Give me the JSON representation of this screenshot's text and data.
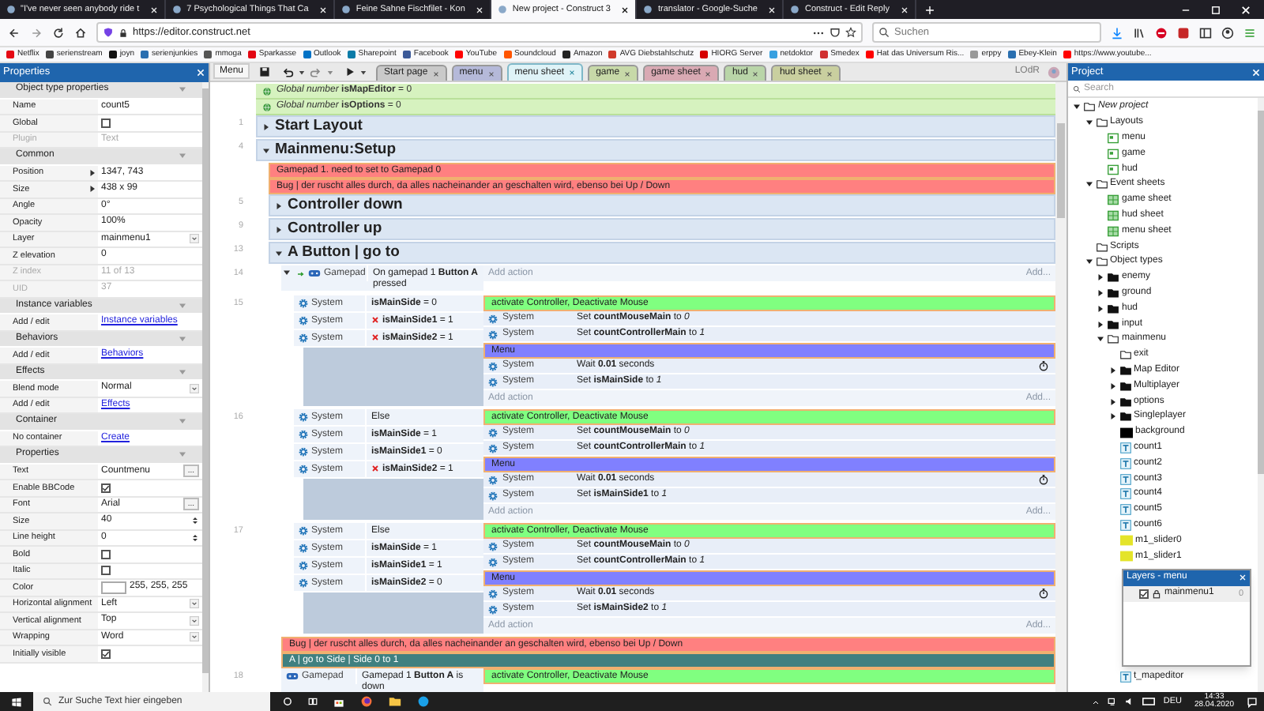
{
  "browser": {
    "tabs": [
      {
        "title": "\"I've never seen anybody ride t",
        "selected": false
      },
      {
        "title": "7 Psychological Things That Ca",
        "selected": false
      },
      {
        "title": "Feine Sahne Fischfilet - Kon",
        "selected": false
      },
      {
        "title": "New project - Construct 3",
        "selected": true
      },
      {
        "title": "translator - Google-Suche",
        "selected": false
      },
      {
        "title": "Construct - Edit Reply",
        "selected": false
      }
    ],
    "url": "https://editor.construct.net",
    "search_placeholder": "Suchen",
    "bookmarks": [
      {
        "label": "Netflix",
        "color": "#e50914"
      },
      {
        "label": "serienstream",
        "color": "#444444"
      },
      {
        "label": "joyn",
        "color": "#111111"
      },
      {
        "label": "serienjunkies",
        "color": "#2a6fb0"
      },
      {
        "label": "mmoga",
        "color": "#555555"
      },
      {
        "label": "Sparkasse",
        "color": "#e30613"
      },
      {
        "label": "Outlook",
        "color": "#0072c6"
      },
      {
        "label": "Sharepoint",
        "color": "#0a7ba8"
      },
      {
        "label": "Facebook",
        "color": "#3b5998"
      },
      {
        "label": "YouTube",
        "color": "#ff0000"
      },
      {
        "label": "Soundcloud",
        "color": "#ff5500"
      },
      {
        "label": "Amazon",
        "color": "#222222"
      },
      {
        "label": "AVG Diebstahlschutz",
        "color": "#d03a2a"
      },
      {
        "label": "HIORG Server",
        "color": "#d60000"
      },
      {
        "label": "netdoktor",
        "color": "#37a0e0"
      },
      {
        "label": "Smedex",
        "color": "#d03030"
      },
      {
        "label": "Hat das Universum Ris...",
        "color": "#ff0000"
      },
      {
        "label": "erppy",
        "color": "#999999"
      },
      {
        "label": "Ebey-Klein",
        "color": "#2a6fb0"
      },
      {
        "label": "https://www.youtube...",
        "color": "#ff0000"
      }
    ]
  },
  "properties": {
    "title": "Properties",
    "sections": [
      {
        "title": "Object type properties",
        "rows": [
          {
            "label": "Name",
            "value": "count5",
            "kind": "text"
          },
          {
            "label": "Global",
            "kind": "checkbox",
            "checked": false
          },
          {
            "label": "Plugin",
            "value": "Text",
            "kind": "readonly"
          }
        ]
      },
      {
        "title": "Common",
        "rows": [
          {
            "label": "Position",
            "value": "1347, 743",
            "kind": "expand"
          },
          {
            "label": "Size",
            "value": "438 x 99",
            "kind": "expand"
          },
          {
            "label": "Angle",
            "value": "0°",
            "kind": "text"
          },
          {
            "label": "Opacity",
            "value": "100%",
            "kind": "text"
          },
          {
            "label": "Layer",
            "value": "mainmenu1",
            "kind": "select"
          },
          {
            "label": "Z elevation",
            "value": "0",
            "kind": "text"
          },
          {
            "label": "Z index",
            "value": "11 of 13",
            "kind": "readonly"
          },
          {
            "label": "UID",
            "value": "37",
            "kind": "readonly"
          }
        ]
      },
      {
        "title": "Instance variables",
        "rows": [
          {
            "label": "Add / edit",
            "value": "Instance variables",
            "kind": "link"
          }
        ]
      },
      {
        "title": "Behaviors",
        "rows": [
          {
            "label": "Add / edit",
            "value": "Behaviors",
            "kind": "link"
          }
        ]
      },
      {
        "title": "Effects",
        "rows": [
          {
            "label": "Blend mode",
            "value": "Normal",
            "kind": "select"
          },
          {
            "label": "Add / edit",
            "value": "Effects",
            "kind": "link"
          }
        ]
      },
      {
        "title": "Container",
        "rows": [
          {
            "label": "No container",
            "value": "Create",
            "kind": "link"
          }
        ]
      },
      {
        "title": "Properties",
        "rows": [
          {
            "label": "Text",
            "value": "Countmenu",
            "kind": "button",
            "button_label": "..."
          },
          {
            "label": "Enable BBCode",
            "kind": "checkbox",
            "checked": true
          },
          {
            "label": "Font",
            "value": "Arial",
            "kind": "button",
            "button_label": "..."
          },
          {
            "label": "Size",
            "value": "40",
            "kind": "spin"
          },
          {
            "label": "Line height",
            "value": "0",
            "kind": "spin"
          },
          {
            "label": "Bold",
            "kind": "checkbox",
            "checked": false
          },
          {
            "label": "Italic",
            "kind": "checkbox",
            "checked": false
          },
          {
            "label": "Color",
            "value": "255, 255, 255",
            "kind": "color"
          },
          {
            "label": "Horizontal alignment",
            "value": "Left",
            "kind": "select"
          },
          {
            "label": "Vertical alignment",
            "value": "Top",
            "kind": "select"
          },
          {
            "label": "Wrapping",
            "value": "Word",
            "kind": "select"
          },
          {
            "label": "Initially visible",
            "kind": "checkbox",
            "checked": true
          }
        ]
      }
    ]
  },
  "toolbar": {
    "menu_button": "Menu",
    "tabs": [
      {
        "label": "Start page",
        "selected": false,
        "color": "#c9c9c9"
      },
      {
        "label": "menu",
        "selected": false,
        "color": "#b5b9d9"
      },
      {
        "label": "menu sheet",
        "selected": true,
        "color": "#dff3f7"
      },
      {
        "label": "game",
        "selected": false,
        "color": "#c7d9a8"
      },
      {
        "label": "game sheet",
        "selected": false,
        "color": "#d9a9b3"
      },
      {
        "label": "hud",
        "selected": false,
        "color": "#b9d5a8"
      },
      {
        "label": "hud sheet",
        "selected": false,
        "color": "#c9cf9f"
      }
    ],
    "user": "LOdR"
  },
  "event_sheet": [
    {
      "kind": "global",
      "text": "*Global number* **isMapEditor** = 0"
    },
    {
      "kind": "global",
      "text": "*Global number* **isOptions** = 0"
    },
    {
      "kind": "group",
      "line": "1",
      "title": "Start Layout",
      "expanded": false
    },
    {
      "kind": "group",
      "line": "4",
      "title": "Mainmenu:Setup",
      "expanded": true,
      "children": [
        {
          "kind": "comment",
          "text": "Gamepad 1. need to set to Gamepad 0",
          "color": "#ff8080"
        },
        {
          "kind": "comment",
          "text": "Bug | der ruscht alles durch, da alles nacheinander an geschalten wird, ebenso bei Up / Down",
          "color": "#ff8080"
        },
        {
          "kind": "group",
          "line": "5",
          "title": "Controller down",
          "expanded": false
        },
        {
          "kind": "group",
          "line": "9",
          "title": "Controller up",
          "expanded": false
        },
        {
          "kind": "group",
          "line": "13",
          "title": "A Button | go to",
          "expanded": true,
          "children": [
            {
              "kind": "event",
              "line": "14",
              "expanded": true,
              "conditions": [
                {
                  "kind": "gamepad_trigger",
                  "object": "Gamepad",
                  "text": "On gamepad 1 **Button A** pressed",
                  "inverted": false
                }
              ],
              "add_action": {
                "label": "Add action",
                "button": "Add..."
              },
              "children": [
                {
                  "kind": "event",
                  "line": "15",
                  "conditions": [
                    {
                      "kind": "system",
                      "object": "System",
                      "text": "**isMainSide** = 0",
                      "inverted": false
                    },
                    {
                      "kind": "system",
                      "object": "System",
                      "text": "**isMainSide1** = 1",
                      "inverted": true
                    },
                    {
                      "kind": "system",
                      "object": "System",
                      "text": "**isMainSide2** = 1",
                      "inverted": true
                    }
                  ],
                  "actions": [
                    {
                      "kind": "comment",
                      "text": "activate Controller, Deactivate Mouse",
                      "color": "#80ff80"
                    },
                    {
                      "kind": "action",
                      "object": "System",
                      "text": "Set **countMouseMain** to *0*"
                    },
                    {
                      "kind": "action",
                      "object": "System",
                      "text": "Set **countControllerMain** to *1*"
                    },
                    {
                      "kind": "comment",
                      "text": "Menu",
                      "color": "#8080ff"
                    },
                    {
                      "kind": "wait",
                      "object": "System",
                      "text": "Wait **0.01** seconds"
                    },
                    {
                      "kind": "action",
                      "object": "System",
                      "text": "Set **isMainSide** to *1*"
                    }
                  ],
                  "add_action": {
                    "label": "Add action",
                    "button": "Add..."
                  }
                },
                {
                  "kind": "event",
                  "line": "16",
                  "conditions": [
                    {
                      "kind": "system",
                      "object": "System",
                      "text": "Else",
                      "inverted": false
                    },
                    {
                      "kind": "system",
                      "object": "System",
                      "text": "**isMainSide** = 1",
                      "inverted": false
                    },
                    {
                      "kind": "system",
                      "object": "System",
                      "text": "**isMainSide1** = 0",
                      "inverted": false
                    },
                    {
                      "kind": "system",
                      "object": "System",
                      "text": "**isMainSide2** = 1",
                      "inverted": true
                    }
                  ],
                  "actions": [
                    {
                      "kind": "comment",
                      "text": "activate Controller, Deactivate Mouse",
                      "color": "#80ff80"
                    },
                    {
                      "kind": "action",
                      "object": "System",
                      "text": "Set **countMouseMain** to *0*"
                    },
                    {
                      "kind": "action",
                      "object": "System",
                      "text": "Set **countControllerMain** to *1*"
                    },
                    {
                      "kind": "comment",
                      "text": "Menu",
                      "color": "#8080ff"
                    },
                    {
                      "kind": "wait",
                      "object": "System",
                      "text": "Wait **0.01** seconds"
                    },
                    {
                      "kind": "action",
                      "object": "System",
                      "text": "Set **isMainSide1** to *1*"
                    }
                  ],
                  "add_action": {
                    "label": "Add action",
                    "button": "Add..."
                  }
                },
                {
                  "kind": "event",
                  "line": "17",
                  "conditions": [
                    {
                      "kind": "system",
                      "object": "System",
                      "text": "Else",
                      "inverted": false
                    },
                    {
                      "kind": "system",
                      "object": "System",
                      "text": "**isMainSide** = 1",
                      "inverted": false
                    },
                    {
                      "kind": "system",
                      "object": "System",
                      "text": "**isMainSide1** = 1",
                      "inverted": false
                    },
                    {
                      "kind": "system",
                      "object": "System",
                      "text": "**isMainSide2** = 0",
                      "inverted": false
                    }
                  ],
                  "actions": [
                    {
                      "kind": "comment",
                      "text": "activate Controller, Deactivate Mouse",
                      "color": "#80ff80"
                    },
                    {
                      "kind": "action",
                      "object": "System",
                      "text": "Set **countMouseMain** to *0*"
                    },
                    {
                      "kind": "action",
                      "object": "System",
                      "text": "Set **countControllerMain** to *1*"
                    },
                    {
                      "kind": "comment",
                      "text": "Menu",
                      "color": "#8080ff"
                    },
                    {
                      "kind": "wait",
                      "object": "System",
                      "text": "Wait **0.01** seconds"
                    },
                    {
                      "kind": "action",
                      "object": "System",
                      "text": "Set **isMainSide2** to *1*"
                    }
                  ],
                  "add_action": {
                    "label": "Add action",
                    "button": "Add..."
                  }
                }
              ]
            },
            {
              "kind": "comment",
              "text": "Bug | der ruscht alles durch, da alles nacheinander an geschalten wird, ebenso bei Up / Down",
              "color": "#ff8080"
            },
            {
              "kind": "comment",
              "text": "A | go to Side | Side 0 to 1",
              "color": "#408080"
            },
            {
              "kind": "event",
              "line": "18",
              "conditions": [
                {
                  "kind": "gamepad",
                  "object": "Gamepad",
                  "text": "Gamepad 1 **Button A** is down",
                  "inverted": false
                }
              ],
              "actions": [
                {
                  "kind": "comment",
                  "text": "activate Controller, Deactivate Mouse",
                  "color": "#80ff80"
                }
              ]
            }
          ]
        }
      ]
    }
  ],
  "project": {
    "title": "Project",
    "search_placeholder": "Search",
    "tree": [
      {
        "label": "New project",
        "kind": "project",
        "expanded": true,
        "children": [
          {
            "label": "Layouts",
            "kind": "folder",
            "expanded": true,
            "children": [
              {
                "label": "menu",
                "kind": "layout"
              },
              {
                "label": "game",
                "kind": "layout"
              },
              {
                "label": "hud",
                "kind": "layout"
              }
            ]
          },
          {
            "label": "Event sheets",
            "kind": "folder",
            "expanded": true,
            "children": [
              {
                "label": "game sheet",
                "kind": "sheet"
              },
              {
                "label": "hud sheet",
                "kind": "sheet"
              },
              {
                "label": "menu sheet",
                "kind": "sheet"
              }
            ]
          },
          {
            "label": "Scripts",
            "kind": "empty_folder"
          },
          {
            "label": "Object types",
            "kind": "folder",
            "expanded": true,
            "children": [
              {
                "label": "enemy",
                "kind": "folder",
                "expanded": false
              },
              {
                "label": "ground",
                "kind": "folder",
                "expanded": false
              },
              {
                "label": "hud",
                "kind": "folder",
                "expanded": false
              },
              {
                "label": "input",
                "kind": "folder",
                "expanded": false
              },
              {
                "label": "mainmenu",
                "kind": "folder",
                "expanded": true,
                "children": [
                  {
                    "label": "exit",
                    "kind": "empty_folder"
                  },
                  {
                    "label": "Map Editor",
                    "kind": "folder",
                    "expanded": false
                  },
                  {
                    "label": "Multiplayer",
                    "kind": "folder",
                    "expanded": false
                  },
                  {
                    "label": "options",
                    "kind": "folder",
                    "expanded": false
                  },
                  {
                    "label": "Singleplayer",
                    "kind": "folder",
                    "expanded": false
                  },
                  {
                    "label": "background",
                    "kind": "sprite",
                    "color": "#000000"
                  },
                  {
                    "label": "count1",
                    "kind": "text"
                  },
                  {
                    "label": "count2",
                    "kind": "text"
                  },
                  {
                    "label": "count3",
                    "kind": "text"
                  },
                  {
                    "label": "count4",
                    "kind": "text"
                  },
                  {
                    "label": "count5",
                    "kind": "text"
                  },
                  {
                    "label": "count6",
                    "kind": "text"
                  },
                  {
                    "label": "m1_slider0",
                    "kind": "sprite",
                    "color": "#e4e42a"
                  },
                  {
                    "label": "m1_slider1",
                    "kind": "sprite",
                    "color": "#e4e42a"
                  }
                ]
              }
            ]
          }
        ]
      }
    ],
    "tree_below_layers": [
      {
        "label": "t_mapeditor",
        "kind": "text"
      }
    ]
  },
  "layers": {
    "title": "Layers - menu",
    "rows": [
      {
        "name": "mainmenu1",
        "count": "0",
        "visible": true
      }
    ]
  },
  "taskbar": {
    "search_placeholder": "Zur Suche Text hier eingeben",
    "language": "DEU",
    "time": "14:33",
    "date": "28.04.2020"
  }
}
